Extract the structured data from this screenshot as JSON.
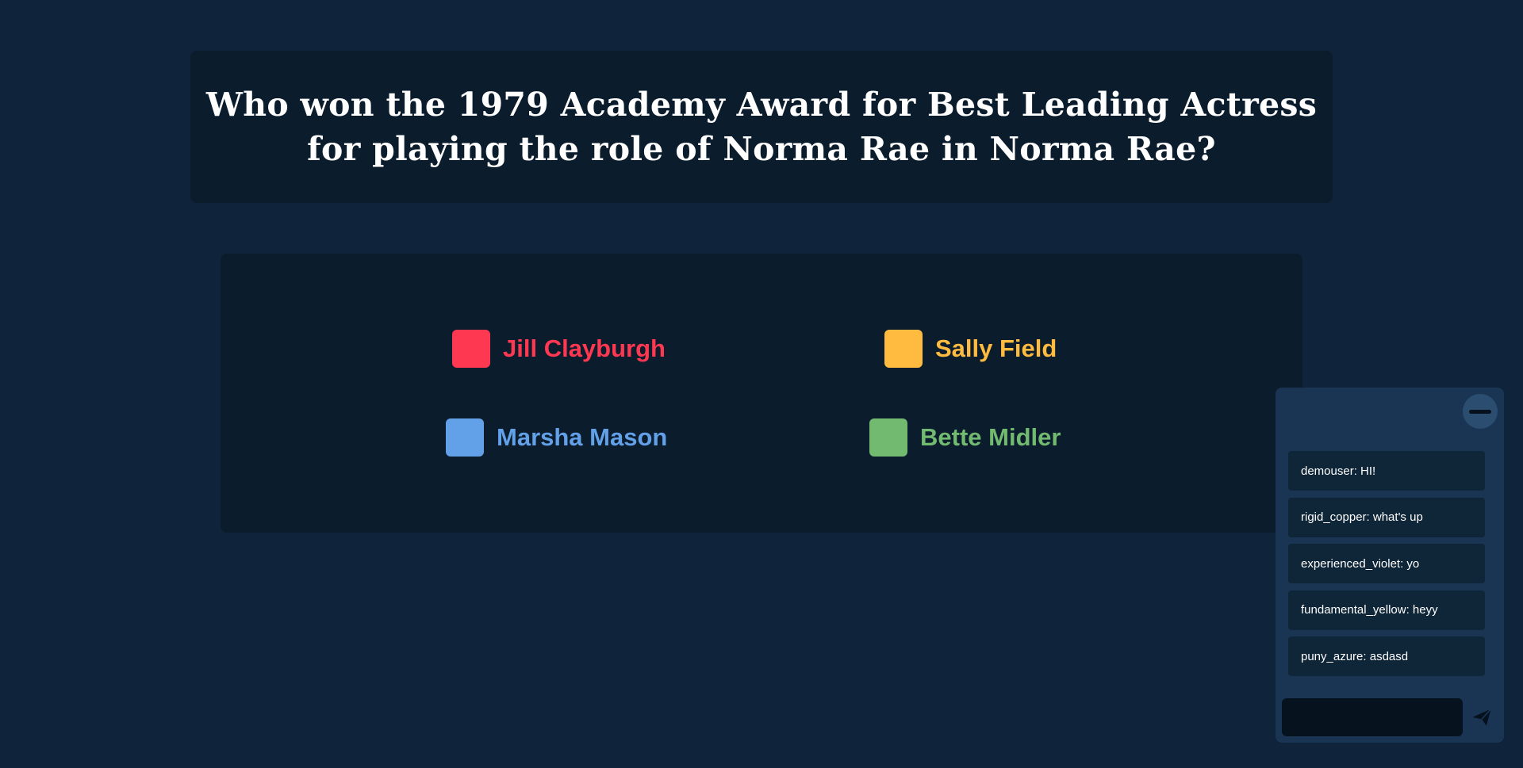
{
  "question": {
    "text": "Who won the 1979 Academy Award for Best Leading Actress for playing the role of Norma Rae in Norma Rae?"
  },
  "answers": [
    {
      "label": "Jill Clayburgh",
      "color": "#ff3852"
    },
    {
      "label": "Sally Field",
      "color": "#ffbb3f"
    },
    {
      "label": "Marsha Mason",
      "color": "#62a0e8"
    },
    {
      "label": "Bette Midler",
      "color": "#73ba71"
    }
  ],
  "chat": {
    "minimize_icon": "minus-icon",
    "messages": [
      "demouser: HI!",
      "rigid_copper: what's up",
      "experienced_violet: yo",
      "fundamental_yellow: heyy",
      "puny_azure: asdasd"
    ],
    "input_value": "",
    "send_icon": "paper-plane-icon"
  }
}
